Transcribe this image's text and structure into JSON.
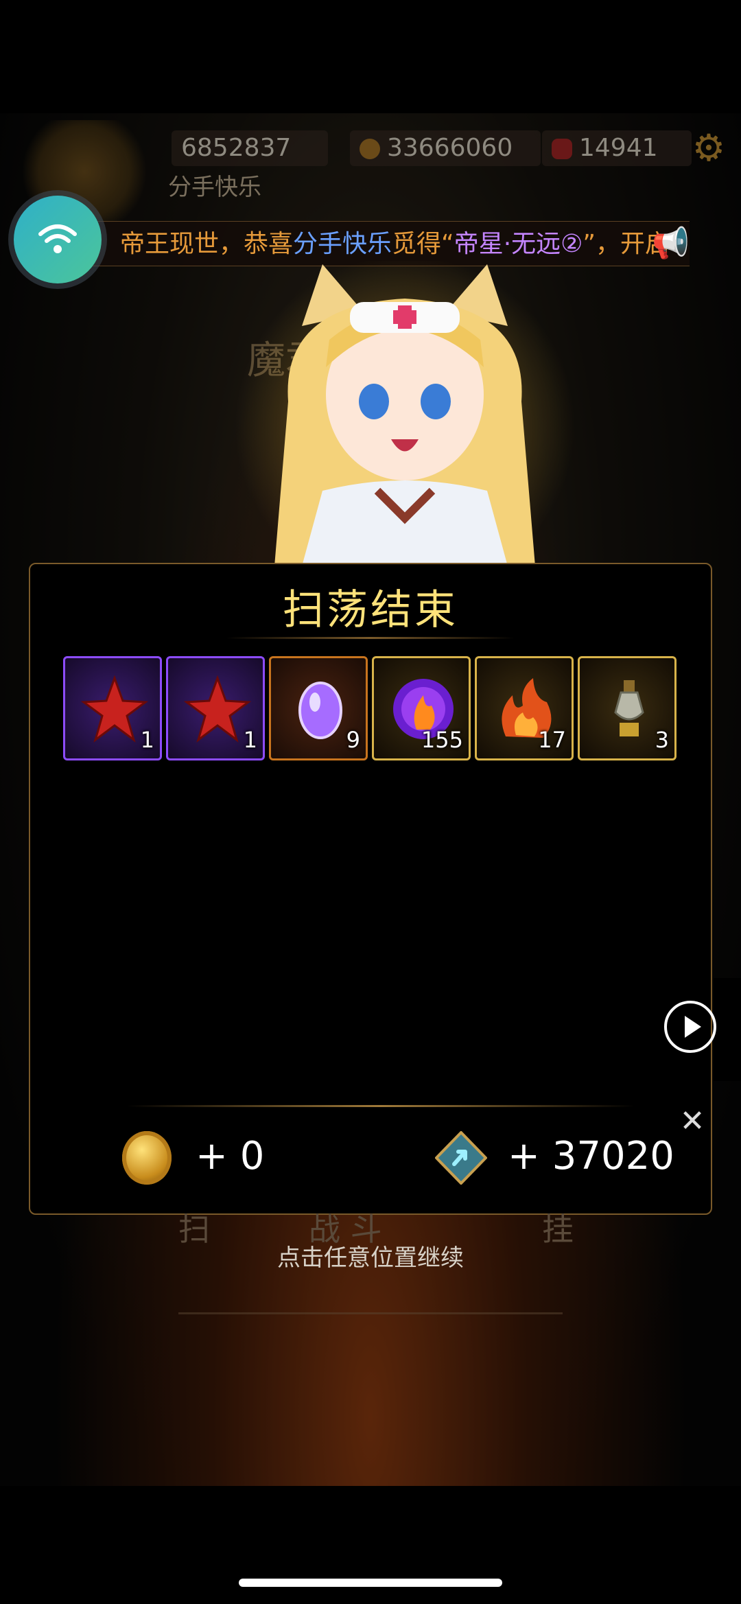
{
  "hud": {
    "power": "6852837",
    "gold": "33666060",
    "gems": "14941",
    "player_name": "分手快乐"
  },
  "marquee": {
    "part1": "帝王现世，恭喜",
    "player": "分手快乐",
    "part2": "觅得“",
    "item": "帝星·无远②",
    "part3": "”，开启"
  },
  "background_title": "魔君",
  "dialog": {
    "title": "扫荡结束",
    "items": [
      {
        "icon": "red-star-shard-icon",
        "rarity": "purple",
        "count": "1"
      },
      {
        "icon": "red-star-shard-icon",
        "rarity": "purple",
        "count": "1"
      },
      {
        "icon": "purple-gem-icon",
        "rarity": "orange",
        "count": "9"
      },
      {
        "icon": "purple-fire-orb-icon",
        "rarity": "gold",
        "count": "155"
      },
      {
        "icon": "flame-essence-icon",
        "rarity": "gold",
        "count": "17"
      },
      {
        "icon": "potion-flask-icon",
        "rarity": "gold",
        "count": "3"
      }
    ],
    "gold_reward": "+ 0",
    "exp_reward": "+ 37020"
  },
  "continue_hint": "点击任意位置继续",
  "bottom": {
    "left_btn": "扫",
    "center_btn": "战  斗",
    "right_btn": "挂"
  },
  "colors": {
    "title": "#ffe27a",
    "purple_rarity": "#8d4cff",
    "orange_rarity": "#c8741e",
    "gold_rarity": "#d8b34a"
  }
}
